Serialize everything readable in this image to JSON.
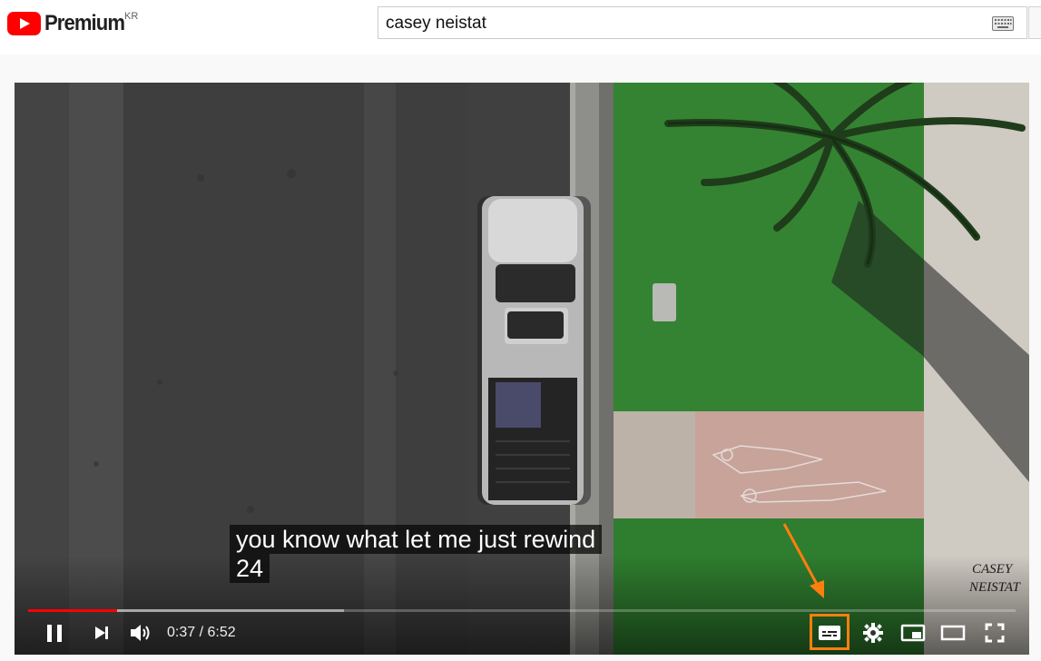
{
  "header": {
    "brand": "Premium",
    "region": "KR",
    "search": {
      "value": "casey neistat"
    }
  },
  "video": {
    "caption_line1": "you know what let me just rewind",
    "caption_line2": "24",
    "watermark": "CASEY NEISTAT",
    "current_time": "0:37",
    "duration": "6:52",
    "time_display": "0:37 / 6:52",
    "progress_played": 0.09,
    "progress_buffered": 0.32
  },
  "annotation": {
    "highlight_color": "#ff7f0e",
    "target": "subtitles-button"
  },
  "colors": {
    "brand_red": "#ff0000",
    "progress_red": "#ff0000"
  },
  "icons": [
    "youtube-logo-icon",
    "keyboard-icon",
    "pause-icon",
    "next-icon",
    "volume-icon",
    "subtitles-icon",
    "settings-icon",
    "miniplayer-icon",
    "theater-mode-icon",
    "fullscreen-icon"
  ]
}
